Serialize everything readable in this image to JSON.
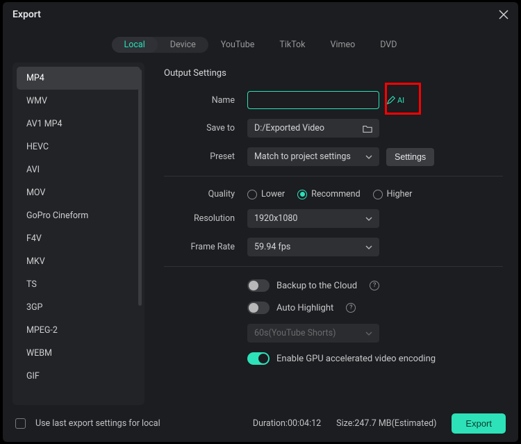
{
  "title": "Export",
  "tabs": {
    "local": "Local",
    "device": "Device",
    "youtube": "YouTube",
    "tiktok": "TikTok",
    "vimeo": "Vimeo",
    "dvd": "DVD"
  },
  "formats": [
    "MP4",
    "WMV",
    "AV1 MP4",
    "HEVC",
    "AVI",
    "MOV",
    "GoPro Cineform",
    "F4V",
    "MKV",
    "TS",
    "3GP",
    "MPEG-2",
    "WEBM",
    "GIF"
  ],
  "section_title": "Output Settings",
  "labels": {
    "name": "Name",
    "save_to": "Save to",
    "preset": "Preset",
    "quality": "Quality",
    "resolution": "Resolution",
    "frame_rate": "Frame Rate"
  },
  "name_value": "",
  "ai_suffix": "AI",
  "save_to_value": "D:/Exported Video",
  "preset_value": "Match to project settings",
  "settings_btn": "Settings",
  "quality": {
    "lower": "Lower",
    "recommend": "Recommend",
    "higher": "Higher",
    "selected": "recommend"
  },
  "resolution_value": "1920x1080",
  "frame_rate_value": "59.94 fps",
  "backup_label": "Backup to the Cloud",
  "auto_hl_label": "Auto Highlight",
  "auto_hl_preset": "60s(YouTube Shorts)",
  "gpu_label": "Enable GPU accelerated video encoding",
  "footer": {
    "use_last": "Use last export settings for local",
    "duration": "Duration:00:04:12",
    "size": "Size:247.7 MB(Estimated)",
    "export": "Export"
  }
}
